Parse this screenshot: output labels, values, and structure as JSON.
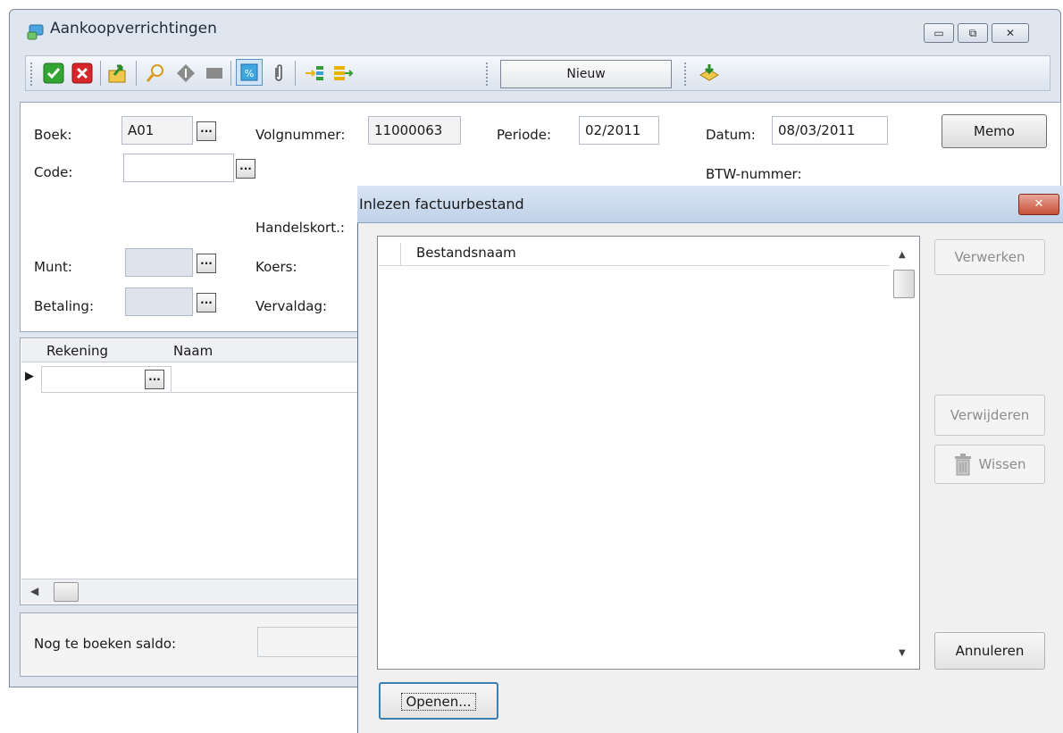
{
  "window": {
    "title": "Aankoopverrichtingen",
    "minimize_glyph": "▭",
    "restore_glyph": "⧉",
    "close_glyph": "✕"
  },
  "toolbar": {
    "icons": [
      "confirm-icon",
      "cancel-icon",
      "export-icon",
      "search-icon",
      "info-icon",
      "stop-icon",
      "percent-icon",
      "paperclip-icon",
      "split-left-icon",
      "split-right-icon",
      "import-icon"
    ],
    "status_field": "Nieuw"
  },
  "form": {
    "boek_label": "Boek:",
    "boek_value": "A01",
    "volgnummer_label": "Volgnummer:",
    "volgnummer_value": "11000063",
    "periode_label": "Periode:",
    "periode_value": "02/2011",
    "datum_label": "Datum:",
    "datum_value": "08/03/2011",
    "memo_label": "Memo",
    "code_label": "Code:",
    "code_value": "",
    "btw_label": "BTW-nummer:",
    "handelskort_label": "Handelskort.:",
    "munt_label": "Munt:",
    "koers_label": "Koers:",
    "betaling_label": "Betaling:",
    "vervaldag_label": "Vervaldag:",
    "ellipsis": "..."
  },
  "grid": {
    "columns": [
      "Rekening",
      "Naam"
    ],
    "row_indicator": "▶"
  },
  "footer": {
    "saldo_label": "Nog te boeken saldo:"
  },
  "dialog": {
    "title": "Inlezen factuurbestand",
    "close_glyph": "✕",
    "column": "Bestandsnaam",
    "buttons": {
      "verwerken": "Verwerken",
      "verwijderen": "Verwijderen",
      "wissen": "Wissen",
      "annuleren": "Annuleren",
      "openen": "Openen..."
    },
    "scroll_up": "▲",
    "scroll_down": "▼"
  },
  "colors": {
    "window_bg": "#dfe6ef",
    "dialog_bg": "#f0f0f0",
    "close_red": "#c75037"
  }
}
